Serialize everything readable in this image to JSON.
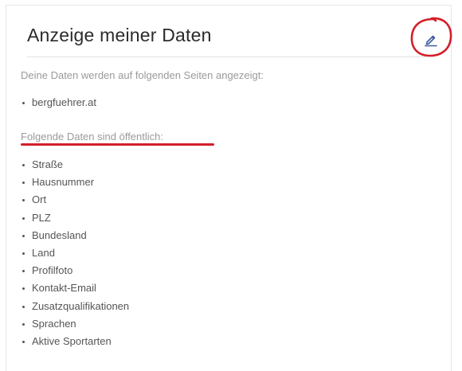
{
  "card": {
    "title": "Anzeige meiner Daten",
    "edit_icon": "pencil-icon",
    "intro": "Deine Daten werden auf folgenden Seiten angezeigt:",
    "sites": [
      "bergfuehrer.at"
    ],
    "public_heading": "Folgende Daten sind öffentlich:",
    "public_fields": [
      "Straße",
      "Hausnummer",
      "Ort",
      "PLZ",
      "Bundesland",
      "Land",
      "Profilfoto",
      "Kontakt-Email",
      "Zusatzqualifikationen",
      "Sprachen",
      "Aktive Sportarten"
    ]
  },
  "colors": {
    "accent_blue": "#3d5a9e",
    "annotation_red": "#d31f2a",
    "muted_text": "#9a9a9a",
    "body_text": "#555555"
  }
}
